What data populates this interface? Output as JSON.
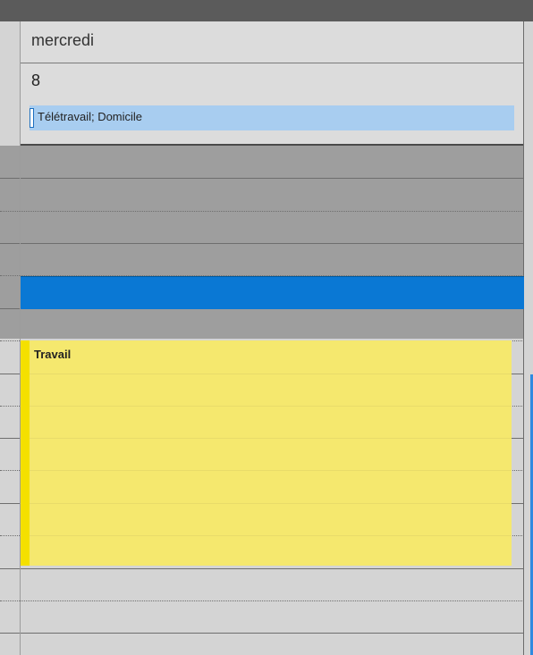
{
  "header": {
    "day_name": "mercredi",
    "day_number": "8"
  },
  "all_day_event": {
    "label": "Télétravail; Domicile",
    "color": "#a8cdf0",
    "border_color": "#1d6fbf"
  },
  "selection": {
    "color": "#0a78d4"
  },
  "event": {
    "title": "Travail",
    "color": "#f5e86e",
    "accent_color": "#f4e000"
  },
  "colors": {
    "off_hours": "#9e9e9e",
    "work_hours": "#d4d4d4"
  }
}
